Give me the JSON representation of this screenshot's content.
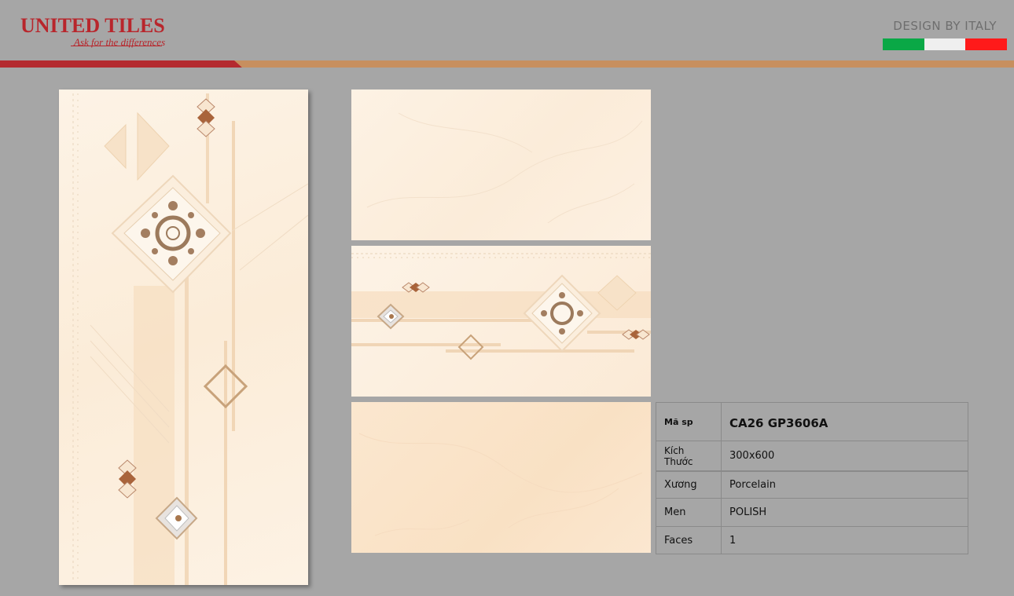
{
  "brand": {
    "name": "UNITED TILES",
    "tagline": "Ask for the differences",
    "design_by": "DESIGN BY ITALY",
    "colors": {
      "brand_red": "#b8262c",
      "accent_tan": "#c78f5f"
    },
    "flag_colors": [
      "#0aa846",
      "#efefef",
      "#ff1a1a"
    ]
  },
  "tiles": [
    {
      "name": "tall-feature-tile",
      "icon": "damask-diamond"
    },
    {
      "name": "plain-wall-tile-light"
    },
    {
      "name": "decor-border-tile",
      "icon": "damask-diamond"
    },
    {
      "name": "plain-wall-tile-warm"
    }
  ],
  "specs": [
    {
      "label": "Mã sp",
      "value": "CA26 GP3606A"
    },
    {
      "label": "Kích Thước",
      "value": "300x600"
    },
    {
      "label": "Xương",
      "value": "Porcelain"
    },
    {
      "label": "Men",
      "value": "POLISH"
    },
    {
      "label": "Faces",
      "value": "1"
    }
  ]
}
